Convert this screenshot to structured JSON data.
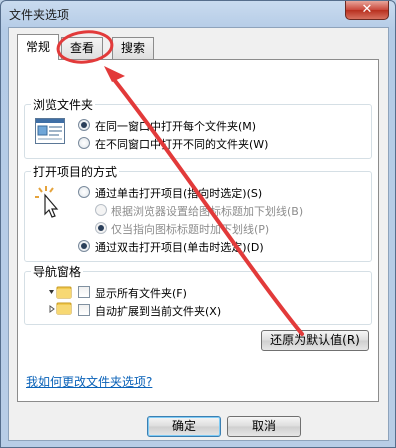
{
  "window": {
    "title": "文件夹选项",
    "close_label": "✕"
  },
  "tabs": [
    {
      "label": "常规",
      "active": true
    },
    {
      "label": "查看",
      "active": false
    },
    {
      "label": "搜索",
      "active": false
    }
  ],
  "browse_group": {
    "title": "浏览文件夹",
    "options": [
      {
        "label": "在同一窗口中打开每个文件夹(M)",
        "checked": true
      },
      {
        "label": "在不同窗口中打开不同的文件夹(W)",
        "checked": false
      }
    ]
  },
  "click_group": {
    "title": "打开项目的方式",
    "options": [
      {
        "label": "通过单击打开项目(指向时选定)(S)",
        "checked": false
      },
      {
        "label": "根据浏览器设置给图标标题加下划线(B)",
        "checked": false,
        "disabled": true
      },
      {
        "label": "仅当指向图标标题时加下划线(P)",
        "checked": true,
        "disabled": true
      },
      {
        "label": "通过双击打开项目(单击时选定)(D)",
        "checked": true
      }
    ]
  },
  "nav_group": {
    "title": "导航窗格",
    "options": [
      {
        "label": "显示所有文件夹(F)",
        "checked": false
      },
      {
        "label": "自动扩展到当前文件夹(X)",
        "checked": false
      }
    ]
  },
  "restore_button": "还原为默认值(R)",
  "help_link": "我如何更改文件夹选项?",
  "footer": {
    "ok": "确定",
    "cancel": "取消"
  },
  "colors": {
    "annotation": "#e23a3a",
    "link": "#0a62b8"
  }
}
